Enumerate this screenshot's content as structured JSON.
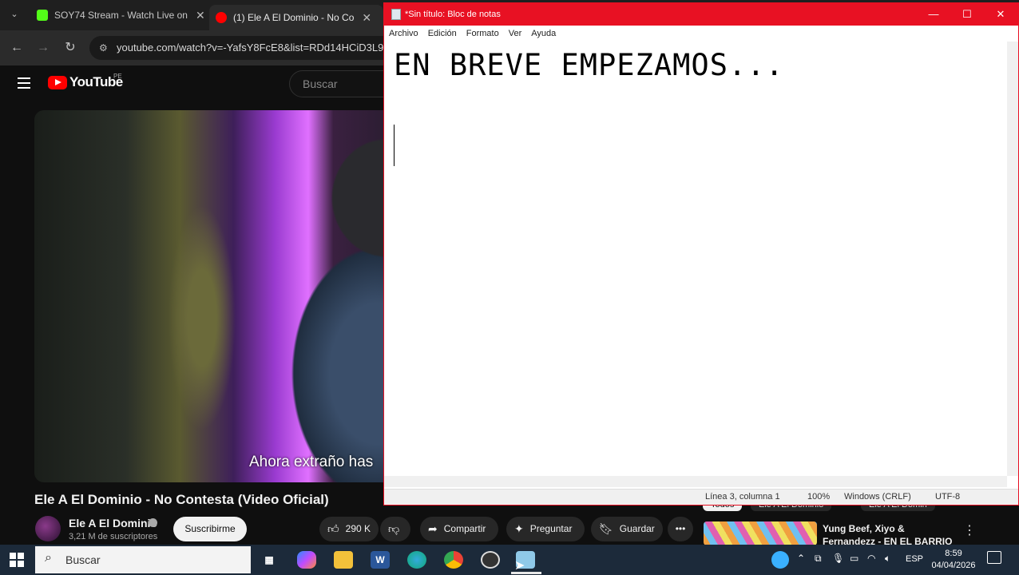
{
  "browser": {
    "tabs": [
      {
        "label": "SOY74 Stream - Watch Live on "
      },
      {
        "label": "(1) Ele A El Dominio - No Co"
      }
    ],
    "address": "youtube.com/watch?v=-YafsY8FcE8&list=RDd14HCiD3L9"
  },
  "youtube": {
    "logo_text": "YouTube",
    "logo_region": "PE",
    "search_placeholder": "Buscar",
    "video_subtitle": "Ahora extraño has",
    "video_title": "Ele A El Dominio - No Contesta (Video Oficial)",
    "channel_name": "Ele A El Dominio",
    "subscribers": "3,21 M de suscriptores",
    "subscribe_label": "Suscribirme",
    "likes": "290 K",
    "share_label": "Compartir",
    "ask_label": "Preguntar",
    "save_label": "Guardar",
    "chips": [
      "Todos",
      "Ele A El Dominio",
      "Ele A El Domin"
    ],
    "rec_title": "Yung Beef, Xiyo & Fernandezz - EN EL BARRIO DE LAS FLORES"
  },
  "notepad": {
    "title": "*Sin título: Bloc de notas",
    "menu": [
      "Archivo",
      "Edición",
      "Formato",
      "Ver",
      "Ayuda"
    ],
    "content": "EN BREVE EMPEZAMOS...",
    "status": {
      "position": "Línea 3, columna 1",
      "zoom": "100%",
      "eol": "Windows (CRLF)",
      "encoding": "UTF-8"
    }
  },
  "taskbar": {
    "search_placeholder": "Buscar",
    "language": "ESP",
    "time": "8:59",
    "date": "04/04/2026"
  },
  "colors": {
    "notepad_accent": "#e81123",
    "youtube_red": "#ff0000",
    "taskbar": "#1c2a3a"
  }
}
